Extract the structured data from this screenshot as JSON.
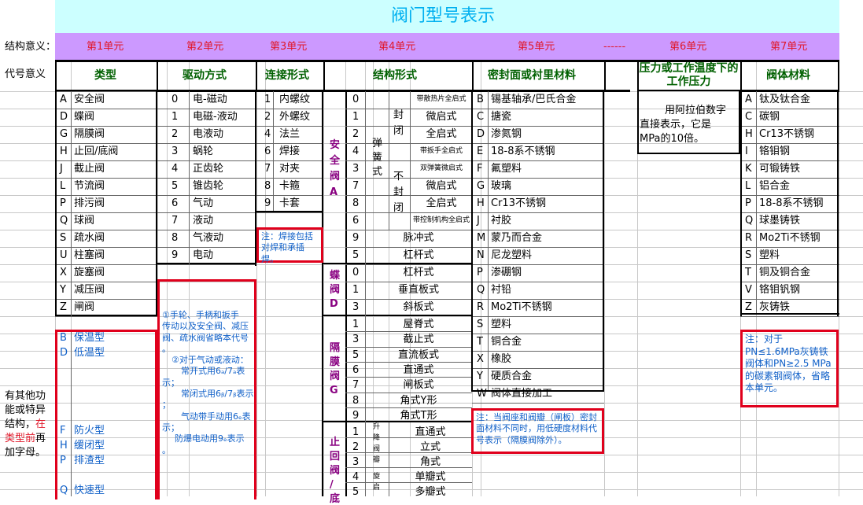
{
  "title": "阀门型号表示",
  "row_labels": {
    "structure": "结构意义：",
    "code": "代号意义"
  },
  "units": [
    "第1单元",
    "第2单元",
    "第3单元",
    "第4单元",
    "第5单元",
    "------",
    "第6单元",
    "第7单元"
  ],
  "headers": [
    "类型",
    "驱动方式",
    "连接形式",
    "结构形式",
    "密封面或衬里材料",
    "压力或工作温度下的工作压力",
    "阀体材料"
  ],
  "type_list": [
    [
      "A",
      "安全阀"
    ],
    [
      "D",
      "蝶阀"
    ],
    [
      "G",
      "隔膜阀"
    ],
    [
      "H",
      "止回/底阀"
    ],
    [
      "J",
      "截止阀"
    ],
    [
      "L",
      "节流阀"
    ],
    [
      "P",
      "排污阀"
    ],
    [
      "Q",
      "球阀"
    ],
    [
      "S",
      "疏水阀"
    ],
    [
      "U",
      "柱塞阀"
    ],
    [
      "X",
      "旋塞阀"
    ],
    [
      "Y",
      "减压阀"
    ],
    [
      "Z",
      "闸阀"
    ]
  ],
  "type_extra": [
    [
      "B",
      "保温型"
    ],
    [
      "D",
      "低温型"
    ],
    [
      "F",
      "防火型"
    ],
    [
      "H",
      "缓闭型"
    ],
    [
      "P",
      "排渣型"
    ],
    [
      "Q",
      "快速型"
    ]
  ],
  "type_note": [
    "有其他功",
    "能或特异",
    "结构，",
    "在",
    "类型前",
    "再",
    "加字母。"
  ],
  "drive_list": [
    [
      "0",
      "电-磁动"
    ],
    [
      "1",
      "电磁-液动"
    ],
    [
      "2",
      "电液动"
    ],
    [
      "3",
      "蜗轮"
    ],
    [
      "4",
      "正齿轮"
    ],
    [
      "5",
      "锥齿轮"
    ],
    [
      "6",
      "气动"
    ],
    [
      "7",
      "液动"
    ],
    [
      "8",
      "气液动"
    ],
    [
      "9",
      "电动"
    ]
  ],
  "drive_note": [
    "①手轮、手柄和扳手",
    "传动以及安全阀、减压",
    "阀、疏水阀省略本代号",
    "。",
    "②对于气动或液动：",
    "常开式用6ₐ/7ₐ表",
    "示；",
    "常闭式用6ᵦ/7ᵦ表示",
    "；",
    "气动带手动用6ₑ表",
    "示；",
    "防爆电动用9ₑ表示",
    "。"
  ],
  "conn_list": [
    [
      "1",
      "内螺纹"
    ],
    [
      "2",
      "外螺纹"
    ],
    [
      "4",
      "法兰"
    ],
    [
      "6",
      "焊接"
    ],
    [
      "7",
      "对夹"
    ],
    [
      "8",
      "卡箍"
    ],
    [
      "9",
      "卡套"
    ]
  ],
  "conn_note": "注：焊接包括对焊和承插焊。",
  "struct": {
    "safety_label": [
      "安",
      "全",
      "阀",
      "A"
    ],
    "safety_codes": [
      "0",
      "1",
      "2",
      "4",
      "3",
      "7",
      "8",
      "6",
      "9",
      "5"
    ],
    "spring": [
      "弹",
      "簧",
      "式"
    ],
    "sealed": [
      "封",
      "闭"
    ],
    "unsealed": [
      "不",
      "封",
      "闭"
    ],
    "safety_names": [
      "带散热片全启式",
      "微启式",
      "全启式",
      "带扳手全启式",
      "双弹簧微启式",
      "微启式",
      "全启式",
      "带控制机构全启式",
      "脉冲式",
      "杠杆式"
    ],
    "butterfly_label": [
      "蝶",
      "阀",
      "D"
    ],
    "butterfly": [
      [
        "0",
        "杠杆式"
      ],
      [
        "1",
        "垂直板式"
      ],
      [
        "3",
        "斜板式"
      ]
    ],
    "diaphragm_label": [
      "隔",
      "膜",
      "阀",
      "G"
    ],
    "diaphragm": [
      [
        "1",
        "屋脊式"
      ],
      [
        "3",
        "截止式"
      ],
      [
        "5",
        "直流板式"
      ],
      [
        "6",
        "直通式"
      ],
      [
        "7",
        "闸板式"
      ],
      [
        "8",
        "角式Y形"
      ],
      [
        "9",
        "角式T形"
      ]
    ],
    "check_label": [
      "止",
      "回",
      "阀",
      "/",
      "底"
    ],
    "lift": [
      "升",
      "降",
      "阀",
      "瓣"
    ],
    "swing": [
      "旋",
      "启"
    ],
    "check": [
      [
        "1",
        "直通式"
      ],
      [
        "2",
        "立式"
      ],
      [
        "3",
        "角式"
      ],
      [
        "4",
        "单瓣式"
      ],
      [
        "5",
        "多瓣式"
      ]
    ]
  },
  "seal_list": [
    [
      "B",
      "锡基轴承/巴氏合金"
    ],
    [
      "C",
      "搪瓷"
    ],
    [
      "D",
      "渗氮钢"
    ],
    [
      "E",
      "18-8系不锈钢"
    ],
    [
      "F",
      "氟塑料"
    ],
    [
      "G",
      "玻璃"
    ],
    [
      "H",
      "Cr13不锈钢"
    ],
    [
      "J",
      "衬胶"
    ],
    [
      "M",
      "蒙乃而合金"
    ],
    [
      "N",
      "尼龙塑料"
    ],
    [
      "P",
      "渗硼钢"
    ],
    [
      "Q",
      "衬铅"
    ],
    [
      "R",
      "Mo2Ti不锈钢"
    ],
    [
      "S",
      "塑料"
    ],
    [
      "T",
      "铜合金"
    ],
    [
      "X",
      "橡胶"
    ],
    [
      "Y",
      "硬质合金"
    ],
    [
      "W",
      "阀体直接加工"
    ]
  ],
  "seal_note": "注：当阀座和阀瓣（闸板）密封面材料不同时，用低硬度材料代号表示（隔膜阀除外）。",
  "pressure_desc": [
    "用阿拉伯数字",
    "直接表示，它是",
    "MPa的10倍。"
  ],
  "body_list": [
    [
      "A",
      "钛及钛合金"
    ],
    [
      "C",
      "碳钢"
    ],
    [
      "H",
      "Cr13不锈钢"
    ],
    [
      "I",
      "铬钼钢"
    ],
    [
      "K",
      "可锻铸铁"
    ],
    [
      "L",
      "铝合金"
    ],
    [
      "P",
      "18-8系不锈钢"
    ],
    [
      "Q",
      "球墨铸铁"
    ],
    [
      "R",
      "Mo2Ti不锈钢"
    ],
    [
      "S",
      "塑料"
    ],
    [
      "T",
      "铜及铜合金"
    ],
    [
      "V",
      "铬钼钒钢"
    ],
    [
      "Z",
      "灰铸铁"
    ]
  ],
  "body_note": "注：对于PN≤1.6MPa灰铸铁阀体和PN≥2.5 MPa的碳素钢阀体，省略本单元。",
  "colors": {
    "title_bg": "#ccffff",
    "unit_bg": "#cc99ff",
    "title_text": "#00b0f0",
    "unit_text": "#e0182a",
    "header_text": "#006000",
    "note_border": "#e0001c",
    "note_text": "#1060c8"
  }
}
